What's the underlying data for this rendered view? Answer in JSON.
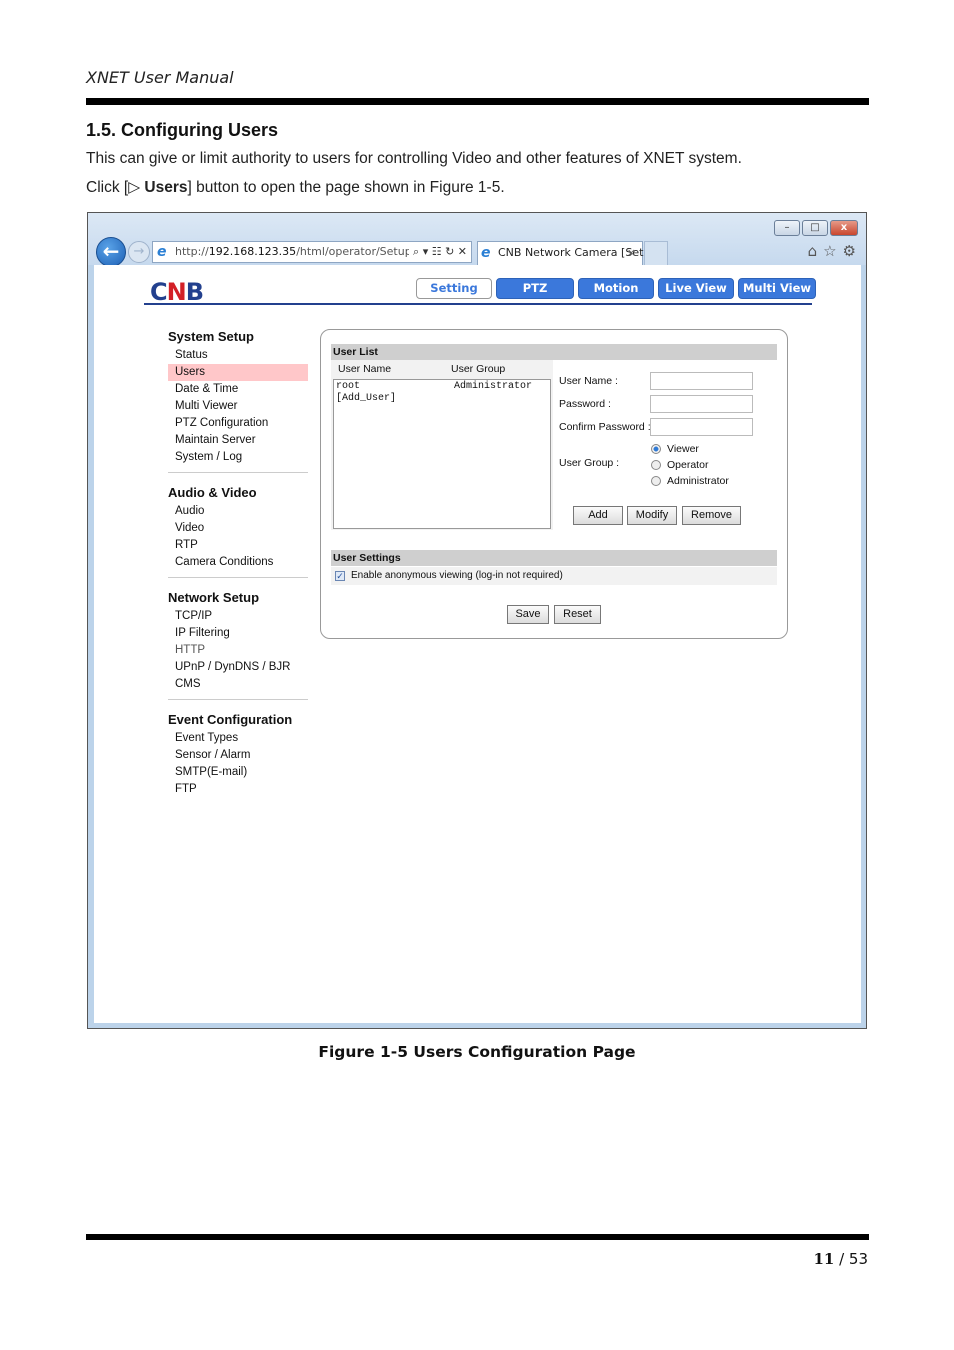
{
  "document": {
    "header": "XNET User Manual",
    "section_title": "1.5. Configuring Users",
    "paragraph1": "This can give or limit authority to users for controlling Video and other features of XNET system.",
    "paragraph2_prefix": "Click [▷ ",
    "paragraph2_bold": "Users",
    "paragraph2_suffix": "] button to open the page shown in Figure 1-5.",
    "figure_caption": "Figure 1-5 Users Configuration Page",
    "page_current": "11",
    "page_separator": " / ",
    "page_total": "53"
  },
  "browser": {
    "window_controls": {
      "minimize": "–",
      "maximize": "□",
      "close": "x"
    },
    "back_icon": "←",
    "forward_icon": "→",
    "address_prefix": "http://",
    "address_host": "192.168.123.35",
    "address_path": "/html/operator/Setup.html",
    "address_tools": "⌕ ▾ ☷ ↻ ✕",
    "tab_title": "CNB Network Camera [Set...",
    "tab_close": "×",
    "right_icons": {
      "home": "⌂",
      "favorites": "☆",
      "tools": "⚙"
    }
  },
  "camera_ui": {
    "logo_left": "C",
    "logo_mid": "N",
    "logo_right": "B",
    "nav": [
      {
        "label": "Setting",
        "active": true
      },
      {
        "label": "PTZ"
      },
      {
        "label": "Motion"
      },
      {
        "label": "Live View"
      },
      {
        "label": "Multi View"
      }
    ],
    "sidebar": [
      {
        "heading": "System Setup",
        "items": [
          "Status",
          "Users",
          "Date & Time",
          "Multi Viewer",
          "PTZ Configuration",
          "Maintain Server",
          "System / Log"
        ],
        "active": "Users"
      },
      {
        "heading": "Audio & Video",
        "items": [
          "Audio",
          "Video",
          "RTP",
          "Camera Conditions"
        ]
      },
      {
        "heading": "Network Setup",
        "items": [
          "TCP/IP",
          "IP Filtering",
          "HTTP",
          "UPnP / DynDNS / BJR",
          "CMS"
        ]
      },
      {
        "heading": "Event Configuration",
        "items": [
          "Event Types",
          "Sensor / Alarm",
          "SMTP(E-mail)",
          "FTP"
        ]
      }
    ],
    "user_list": {
      "title": "User List",
      "col_name": "User Name",
      "col_group": "User Group",
      "rows": [
        {
          "name": "root",
          "group": "Administrator"
        },
        {
          "name": "[Add_User]",
          "group": ""
        }
      ]
    },
    "form": {
      "user_name_label": "User Name :",
      "user_name_value": "",
      "password_label": "Password :",
      "password_value": "",
      "confirm_label": "Confirm Password :",
      "confirm_value": "",
      "group_label": "User Group :",
      "group_options": [
        "Viewer",
        "Operator",
        "Administrator"
      ],
      "group_selected": "Viewer",
      "add_label": "Add",
      "modify_label": "Modify",
      "remove_label": "Remove"
    },
    "user_settings": {
      "title": "User Settings",
      "anon_label": "Enable anonymous viewing (log-in not required)",
      "anon_checked": true,
      "check_glyph": "✓",
      "save_label": "Save",
      "reset_label": "Reset"
    }
  }
}
